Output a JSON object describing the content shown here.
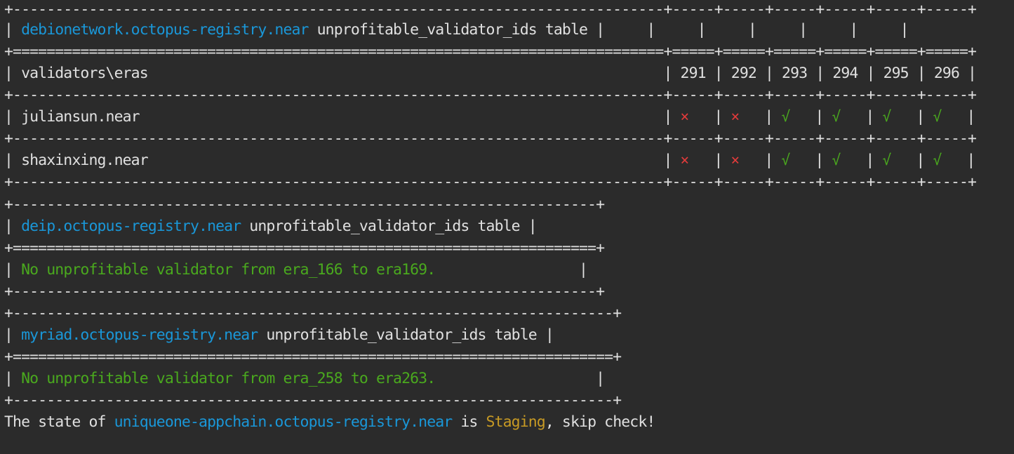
{
  "colors": {
    "background": "#2b2b2b",
    "default": "#e0e0e0",
    "blue": "#1a97d8",
    "green": "#4aa91e",
    "red": "#e23b3b",
    "yellow": "#c79a24"
  },
  "lines": [
    [
      {
        "t": "+-----------------------------------------------------------------------------+-----+-----+-----+-----+-----+-----+",
        "c": "default"
      }
    ],
    [
      {
        "t": "| ",
        "c": "default"
      },
      {
        "t": "debionetwork.octopus-registry.near",
        "c": "blue"
      },
      {
        "t": " unprofitable_validator_ids table |     |     |     |     |     |     |",
        "c": "default"
      }
    ],
    [
      {
        "t": "+=============================================================================+=====+=====+=====+=====+=====+=====+",
        "c": "default"
      }
    ],
    [
      {
        "t": "| validators\\eras                                                             | 291 | 292 | 293 | 294 | 295 | 296 |",
        "c": "default"
      }
    ],
    [
      {
        "t": "+-----------------------------------------------------------------------------+-----+-----+-----+-----+-----+-----+",
        "c": "default"
      }
    ],
    [
      {
        "t": "| juliansun.near                                                              | ",
        "c": "default"
      },
      {
        "t": "×",
        "c": "red"
      },
      {
        "t": "   | ",
        "c": "default"
      },
      {
        "t": "×",
        "c": "red"
      },
      {
        "t": "   | ",
        "c": "default"
      },
      {
        "t": "√",
        "c": "green"
      },
      {
        "t": "   | ",
        "c": "default"
      },
      {
        "t": "√",
        "c": "green"
      },
      {
        "t": "   | ",
        "c": "default"
      },
      {
        "t": "√",
        "c": "green"
      },
      {
        "t": "   | ",
        "c": "default"
      },
      {
        "t": "√",
        "c": "green"
      },
      {
        "t": "   |",
        "c": "default"
      }
    ],
    [
      {
        "t": "+-----------------------------------------------------------------------------+-----+-----+-----+-----+-----+-----+",
        "c": "default"
      }
    ],
    [
      {
        "t": "| shaxinxing.near                                                             | ",
        "c": "default"
      },
      {
        "t": "×",
        "c": "red"
      },
      {
        "t": "   | ",
        "c": "default"
      },
      {
        "t": "×",
        "c": "red"
      },
      {
        "t": "   | ",
        "c": "default"
      },
      {
        "t": "√",
        "c": "green"
      },
      {
        "t": "   | ",
        "c": "default"
      },
      {
        "t": "√",
        "c": "green"
      },
      {
        "t": "   | ",
        "c": "default"
      },
      {
        "t": "√",
        "c": "green"
      },
      {
        "t": "   | ",
        "c": "default"
      },
      {
        "t": "√",
        "c": "green"
      },
      {
        "t": "   |",
        "c": "default"
      }
    ],
    [
      {
        "t": "+-----------------------------------------------------------------------------+-----+-----+-----+-----+-----+-----+",
        "c": "default"
      }
    ],
    [
      {
        "t": "+---------------------------------------------------------------------+",
        "c": "default"
      }
    ],
    [
      {
        "t": "| ",
        "c": "default"
      },
      {
        "t": "deip.octopus-registry.near",
        "c": "blue"
      },
      {
        "t": " unprofitable_validator_ids table |",
        "c": "default"
      }
    ],
    [
      {
        "t": "+=====================================================================+",
        "c": "default"
      }
    ],
    [
      {
        "t": "| ",
        "c": "default"
      },
      {
        "t": "No unprofitable validator from era_166 to era169.",
        "c": "green"
      },
      {
        "t": "                 |",
        "c": "default"
      }
    ],
    [
      {
        "t": "+---------------------------------------------------------------------+",
        "c": "default"
      }
    ],
    [
      {
        "t": "+-----------------------------------------------------------------------+",
        "c": "default"
      }
    ],
    [
      {
        "t": "| ",
        "c": "default"
      },
      {
        "t": "myriad.octopus-registry.near",
        "c": "blue"
      },
      {
        "t": " unprofitable_validator_ids table |",
        "c": "default"
      }
    ],
    [
      {
        "t": "+=======================================================================+",
        "c": "default"
      }
    ],
    [
      {
        "t": "| ",
        "c": "default"
      },
      {
        "t": "No unprofitable validator from era_258 to era263.",
        "c": "green"
      },
      {
        "t": "                   |",
        "c": "default"
      }
    ],
    [
      {
        "t": "+-----------------------------------------------------------------------+",
        "c": "default"
      }
    ],
    [
      {
        "t": "The state of ",
        "c": "default"
      },
      {
        "t": "uniqueone-appchain.octopus-registry.near",
        "c": "blue"
      },
      {
        "t": " is ",
        "c": "default"
      },
      {
        "t": "Staging",
        "c": "yellow"
      },
      {
        "t": ", skip check!",
        "c": "default"
      }
    ]
  ]
}
